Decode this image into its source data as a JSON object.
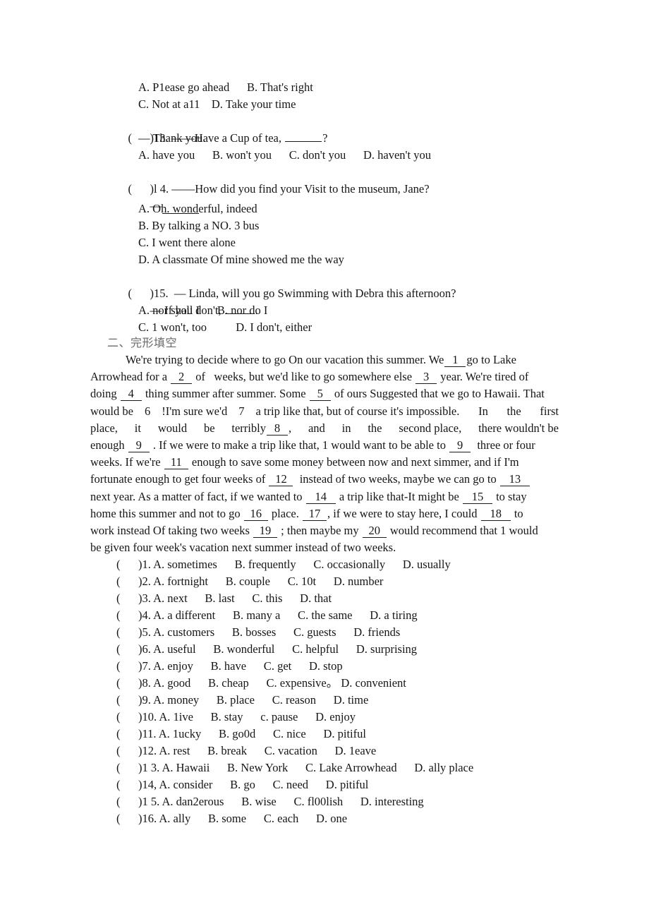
{
  "document": {
    "kind": "english-exam-worksheet-page",
    "section_heading_cn": "二、完形填空"
  },
  "top_options": {
    "line_a_b": "A. P1ease go ahead      B. That's right",
    "line_c_d": "C. Not at a11    D. Take your time"
  },
  "questions": [
    {
      "number": "13",
      "paren": "(",
      "stem_prefix": ")13. ——Have a Cup of tea, ",
      "stem_suffix": "?",
      "reply": "— Thank you.",
      "options_line": "A. have you      B. won't you      C. don't you      D. haven't you"
    },
    {
      "number": "14",
      "paren": "(",
      "stem_prefix": ")l 4. ——How did you find your Visit to the museum, Jane?",
      "reply": "—",
      "option_a": "A. Oh. wonderful, indeed",
      "option_b": "B. By talking a NO. 3 bus",
      "option_c": "C. I went there alone",
      "option_d": "D. A classmate Of mine showed me the way"
    },
    {
      "number": "15",
      "paren": "(",
      "stem_prefix": ")15.  — Linda, will you go Swimming with Debra this afternoon?",
      "reply_prefix": "— If you don't, ",
      "reply_suffix": ".",
      "options_line_1": "A. nor shall I      B. nor do I",
      "options_line_2": "C. 1 won't, too          D. I don't, either"
    }
  ],
  "passage": {
    "line1_indent_text": "We're trying to decide where to go On our vacation this summer. We",
    "line1_blank": "1",
    "line1_tail": "go to Lake",
    "line2_a": "Arrowhead for a ",
    "line2_blank1": "2",
    "line2_b": " of   weeks, but we'd like to go somewhere else ",
    "line2_blank2": "3",
    "line2_c": " year. We're tired of",
    "line3_a": "doing ",
    "line3_blank1": "4",
    "line3_b": " thing summer after summer. Some ",
    "line3_blank2": "5",
    "line3_c": " of ours Suggested that we go to Hawaii. That",
    "line4_a": "would be ",
    "line4_blank1": "6",
    "line4_b": " !I'm sure we'd ",
    "line4_blank2": "7",
    "line4_c": " a trip like that, but of course it's impossible.",
    "line4_just_1": "In",
    "line4_just_2": "the",
    "line4_just_3": "first",
    "line5_w1": "place,",
    "line5_w2": "it",
    "line5_w3": "would",
    "line5_w4": "be",
    "line5_w5": "terribly",
    "line5_blank": "8",
    "line5_w6": ",",
    "line5_w7": "and",
    "line5_w8": "in",
    "line5_w9": "the",
    "line5_w10": "second place,",
    "line5_w11": "there wouldn't be",
    "line6_a": "enough ",
    "line6_blank1": "9",
    "line6_b": " . If we were to make a trip like that, 1 would want to be able to ",
    "line6_blank2": "9",
    "line6_c": "  three or four",
    "line7_a": "weeks. If we're ",
    "line7_blank": "11",
    "line7_b": " enough to save some money between now and next simmer, and if I'm",
    "line8_a": "fortunate enough to get four weeks of ",
    "line8_blank1": "12",
    "line8_b": "  instead of two weeks, maybe we can go to ",
    "line8_blank2": "13",
    "line9_a": "next year. As a matter of fact, if we wanted to ",
    "line9_blank1": "14",
    "line9_b": " a trip like that-It might be ",
    "line9_blank2": "15",
    "line9_c": " to stay",
    "line10_a": "home this summer and not to go ",
    "line10_blank1": "16",
    "line10_b": " place. ",
    "line10_blank2": "17",
    "line10_c": ", if we were to stay here, I could ",
    "line10_blank3": "18",
    "line10_d": " to",
    "line11_a": "work instead Of taking two weeks ",
    "line11_blank1": "19",
    "line11_b": " ; then maybe my ",
    "line11_blank2": "20",
    "line11_c": " would recommend that 1 would",
    "line12": "be given four week's vacation next summer instead of two weeks."
  },
  "cloze_options": [
    {
      "lead": "(",
      "text": ")1. A. sometimes      B. frequently      C. occasionally      D. usually"
    },
    {
      "lead": "(",
      "text": ")2. A. fortnight      B. couple      C. 10t      D. number"
    },
    {
      "lead": "(",
      "text": ")3. A. next      B. last      C. this      D. that"
    },
    {
      "lead": "(",
      "text": ")4. A. a different      B. many a      C. the same      D. a tiring"
    },
    {
      "lead": "(",
      "text": ")5. A. customers      B. bosses      C. guests      D. friends"
    },
    {
      "lead": "(",
      "text": ")6. A. useful      B. wonderful      C. helpful      D. surprising"
    },
    {
      "lead": "(",
      "text": ")7. A. enjoy      B. have      C. get      D. stop"
    },
    {
      "lead": "(",
      "text": ")8. A. good      B. cheap      C. expensive。 D. convenient"
    },
    {
      "lead": "(",
      "text": ")9. A. money      B. place      C. reason      D. time"
    },
    {
      "lead": "(",
      "text": ")10. A. 1ive      B. stay      c. pause      D. enjoy"
    },
    {
      "lead": "(",
      "text": ")11. A. 1ucky      B. go0d      C. nice      D. pitiful"
    },
    {
      "lead": "(",
      "text": ")12. A. rest      B. break      C. vacation      D. 1eave"
    },
    {
      "lead": "(",
      "text": ")1 3. A. Hawaii      B. New York      C. Lake Arrowhead      D. ally place"
    },
    {
      "lead": "(",
      "text": ")14, A. consider      B. go      C. need      D. pitiful"
    },
    {
      "lead": "(",
      "text": ")1 5. A. dan2erous      B. wise      C. fl00lish      D. interesting"
    },
    {
      "lead": "(",
      "text": ")16. A. ally      B. some      C. each      D. one"
    }
  ]
}
